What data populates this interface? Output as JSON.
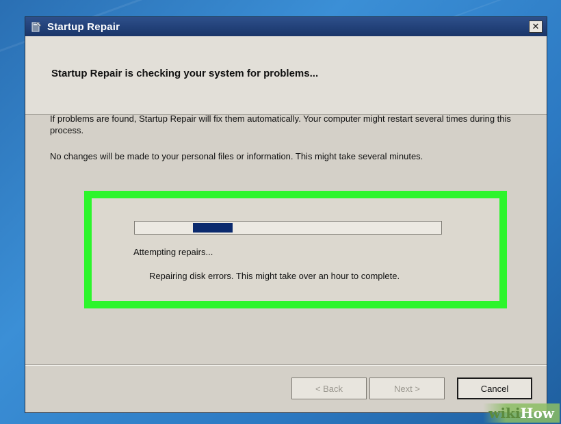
{
  "window": {
    "title": "Startup Repair",
    "close_glyph": "✕",
    "icon": "startup-repair-icon"
  },
  "header": {
    "title": "Startup Repair is checking your system for problems..."
  },
  "body": {
    "paragraph1": "If problems are found, Startup Repair will fix them automatically. Your computer might restart several times during this process.",
    "paragraph2": "No changes will be made to your personal files or information. This might take several minutes."
  },
  "progress": {
    "segment_start": 0.19,
    "segment_fraction": 0.13,
    "color": "#0b2a6e",
    "status": "Attempting repairs...",
    "detail": "Repairing disk errors. This might take over an hour to complete."
  },
  "buttons": {
    "back": "< Back",
    "next": "Next >",
    "cancel": "Cancel"
  },
  "watermark": {
    "part1": "wiki",
    "part2": "How"
  },
  "colors": {
    "highlight": "#2cf52c",
    "titlebar": "#23427a",
    "dialog_bg": "#d4d0c8"
  }
}
